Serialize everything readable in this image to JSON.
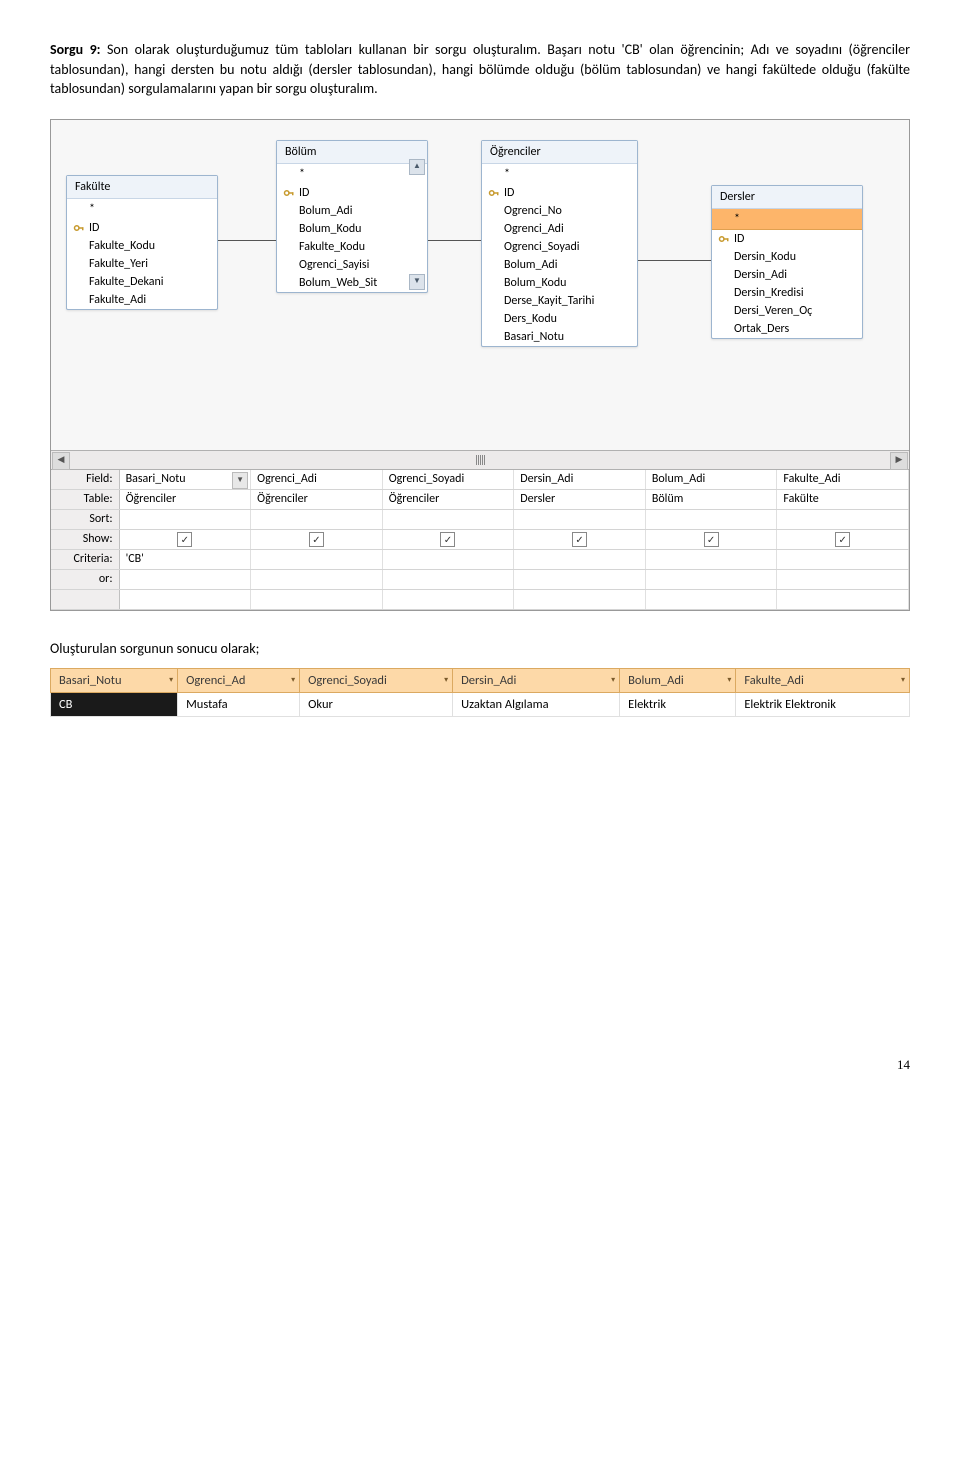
{
  "paragraphs": {
    "p1_bold": "Sorgu 9: ",
    "p1_rest": "Son olarak oluşturduğumuz tüm tabloları kullanan bir sorgu oluşturalım. Başarı notu 'CB' olan öğrencinin; Adı ve soyadını (öğrenciler tablosundan), hangi dersten bu notu aldığı (dersler tablosundan), hangi bölümde olduğu (bölüm tablosundan) ve hangi fakültede olduğu (fakülte tablosundan) sorgulamalarını yapan bir sorgu oluşturalım."
  },
  "tables": {
    "fakulte": {
      "title": "Fakülte",
      "star": "*",
      "fields": [
        {
          "key": true,
          "name": "ID"
        },
        {
          "key": false,
          "name": "Fakulte_Kodu"
        },
        {
          "key": false,
          "name": "Fakulte_Yeri"
        },
        {
          "key": false,
          "name": "Fakulte_Dekani"
        },
        {
          "key": false,
          "name": "Fakulte_Adi"
        }
      ]
    },
    "bolum": {
      "title": "Bölüm",
      "star": "*",
      "fields": [
        {
          "key": true,
          "name": "ID"
        },
        {
          "key": false,
          "name": "Bolum_Adi"
        },
        {
          "key": false,
          "name": "Bolum_Kodu"
        },
        {
          "key": false,
          "name": "Fakulte_Kodu"
        },
        {
          "key": false,
          "name": "Ogrenci_Sayisi"
        },
        {
          "key": false,
          "name": "Bolum_Web_Sit"
        }
      ]
    },
    "ogrenciler": {
      "title": "Öğrenciler",
      "star": "*",
      "fields": [
        {
          "key": true,
          "name": "ID"
        },
        {
          "key": false,
          "name": "Ogrenci_No"
        },
        {
          "key": false,
          "name": "Ogrenci_Adi"
        },
        {
          "key": false,
          "name": "Ogrenci_Soyadi"
        },
        {
          "key": false,
          "name": "Bolum_Adi"
        },
        {
          "key": false,
          "name": "Bolum_Kodu"
        },
        {
          "key": false,
          "name": "Derse_Kayit_Tarihi"
        },
        {
          "key": false,
          "name": "Ders_Kodu"
        },
        {
          "key": false,
          "name": "Basari_Notu"
        }
      ]
    },
    "dersler": {
      "title": "Dersler",
      "star": "*",
      "fields": [
        {
          "key": true,
          "name": "ID"
        },
        {
          "key": false,
          "name": "Dersin_Kodu"
        },
        {
          "key": false,
          "name": "Dersin_Adi"
        },
        {
          "key": false,
          "name": "Dersin_Kredisi"
        },
        {
          "key": false,
          "name": "Dersi_Veren_Oç"
        },
        {
          "key": false,
          "name": "Ortak_Ders"
        }
      ]
    }
  },
  "grid": {
    "labels": {
      "field": "Field:",
      "table": "Table:",
      "sort": "Sort:",
      "show": "Show:",
      "criteria": "Criteria:",
      "or": "or:"
    },
    "columns": [
      {
        "field": "Basari_Notu",
        "table": "Öğrenciler",
        "show": true,
        "criteria": "'CB'",
        "dropdown": true
      },
      {
        "field": "Ogrenci_Adi",
        "table": "Öğrenciler",
        "show": true,
        "criteria": ""
      },
      {
        "field": "Ogrenci_Soyadi",
        "table": "Öğrenciler",
        "show": true,
        "criteria": ""
      },
      {
        "field": "Dersin_Adi",
        "table": "Dersler",
        "show": true,
        "criteria": ""
      },
      {
        "field": "Bolum_Adi",
        "table": "Bölüm",
        "show": true,
        "criteria": ""
      },
      {
        "field": "Fakulte_Adi",
        "table": "Fakülte",
        "show": true,
        "criteria": ""
      }
    ]
  },
  "results_note": "Oluşturulan sorgunun sonucu olarak;",
  "results": {
    "headers": [
      "Basari_Notu",
      "Ogrenci_Ad",
      "Ogrenci_Soyadi",
      "Dersin_Adi",
      "Bolum_Adi",
      "Fakulte_Adi"
    ],
    "rows": [
      [
        "CB",
        "Mustafa",
        "Okur",
        "Uzaktan Algılama",
        "Elektrik",
        "Elektrik Elektronik"
      ]
    ]
  },
  "page_number": "14"
}
